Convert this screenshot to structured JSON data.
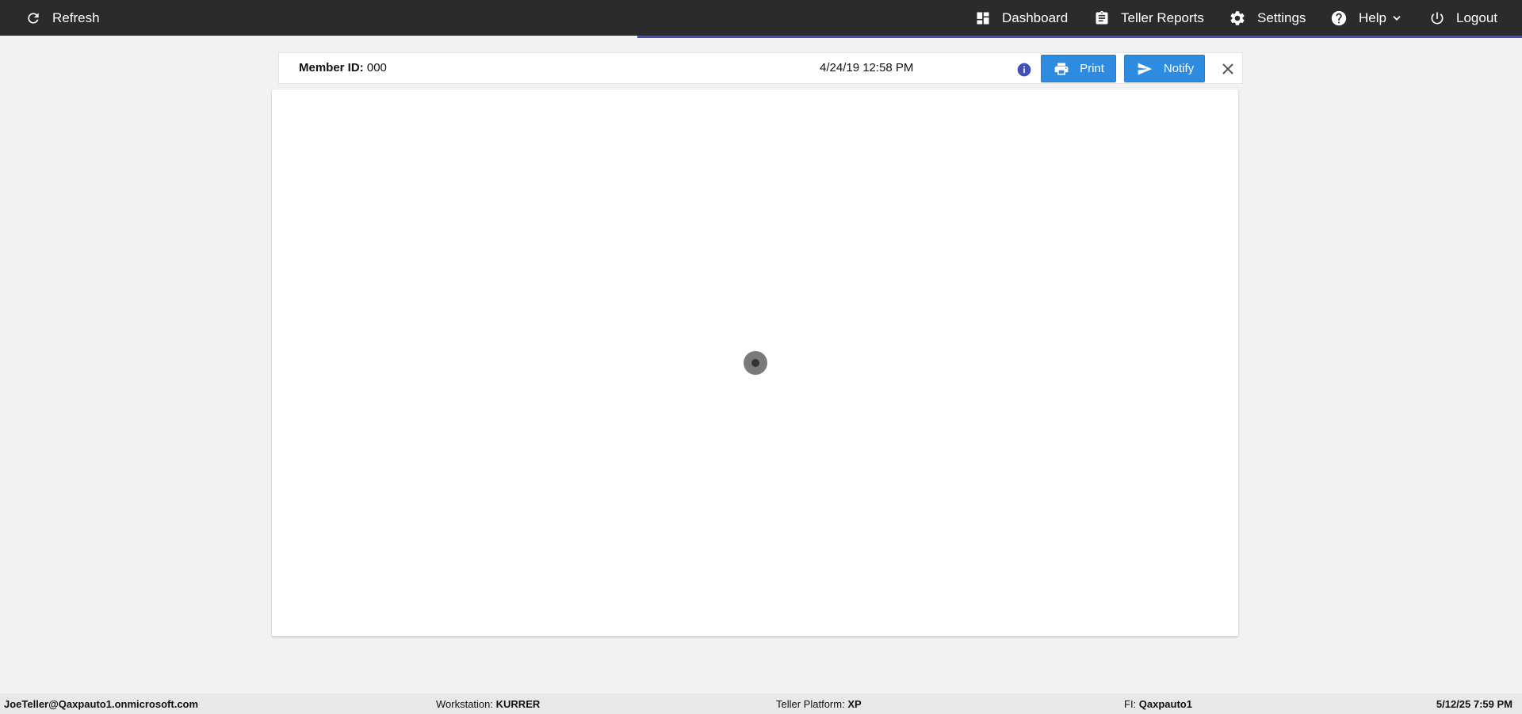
{
  "topbar": {
    "refresh_label": "Refresh",
    "dashboard_label": "Dashboard",
    "teller_reports_label": "Teller Reports",
    "settings_label": "Settings",
    "help_label": "Help",
    "logout_label": "Logout"
  },
  "member": {
    "id_label": "Member ID:",
    "id_value": "000",
    "datetime": "4/24/19 12:58 PM",
    "print_label": "Print",
    "notify_label": "Notify"
  },
  "status": {
    "user": "JoeTeller@Qaxpauto1.onmicrosoft.com",
    "workstation_label": "Workstation:",
    "workstation_value": "KURRER",
    "platform_label": "Teller Platform:",
    "platform_value": "XP",
    "fi_label": "FI:",
    "fi_value": "Qaxpauto1",
    "datetime": "5/12/25 7:59 PM"
  },
  "colors": {
    "topbar_bg": "#2b2b2b",
    "accent_blue": "#2d8ce0",
    "progress_indigo": "#3f51b5",
    "info_icon": "#3f51b5"
  },
  "icons": {
    "refresh": "refresh-icon",
    "dashboard": "dashboard-icon",
    "teller_reports": "clipboard-icon",
    "settings": "gear-icon",
    "help": "help-circle-icon",
    "help_dropdown": "chevron-down-icon",
    "logout": "power-icon",
    "info": "info-icon",
    "print": "printer-icon",
    "notify": "send-icon",
    "close": "close-icon",
    "loading": "loading-spinner"
  }
}
